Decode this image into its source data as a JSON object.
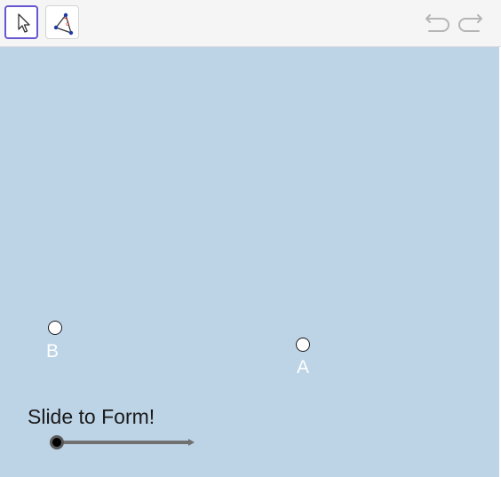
{
  "toolbar": {
    "tools": [
      {
        "icon": "cursor-arrow-icon",
        "selected": true
      },
      {
        "icon": "polygon-angle-icon",
        "selected": false
      }
    ],
    "undo_icon": "undo-icon",
    "redo_icon": "redo-icon"
  },
  "graphics": {
    "background_color": "#bdd3e6",
    "points": [
      {
        "name": "B"
      },
      {
        "name": "A"
      }
    ],
    "slider": {
      "caption": "Slide to Form!",
      "value_fraction": 0.0
    }
  }
}
